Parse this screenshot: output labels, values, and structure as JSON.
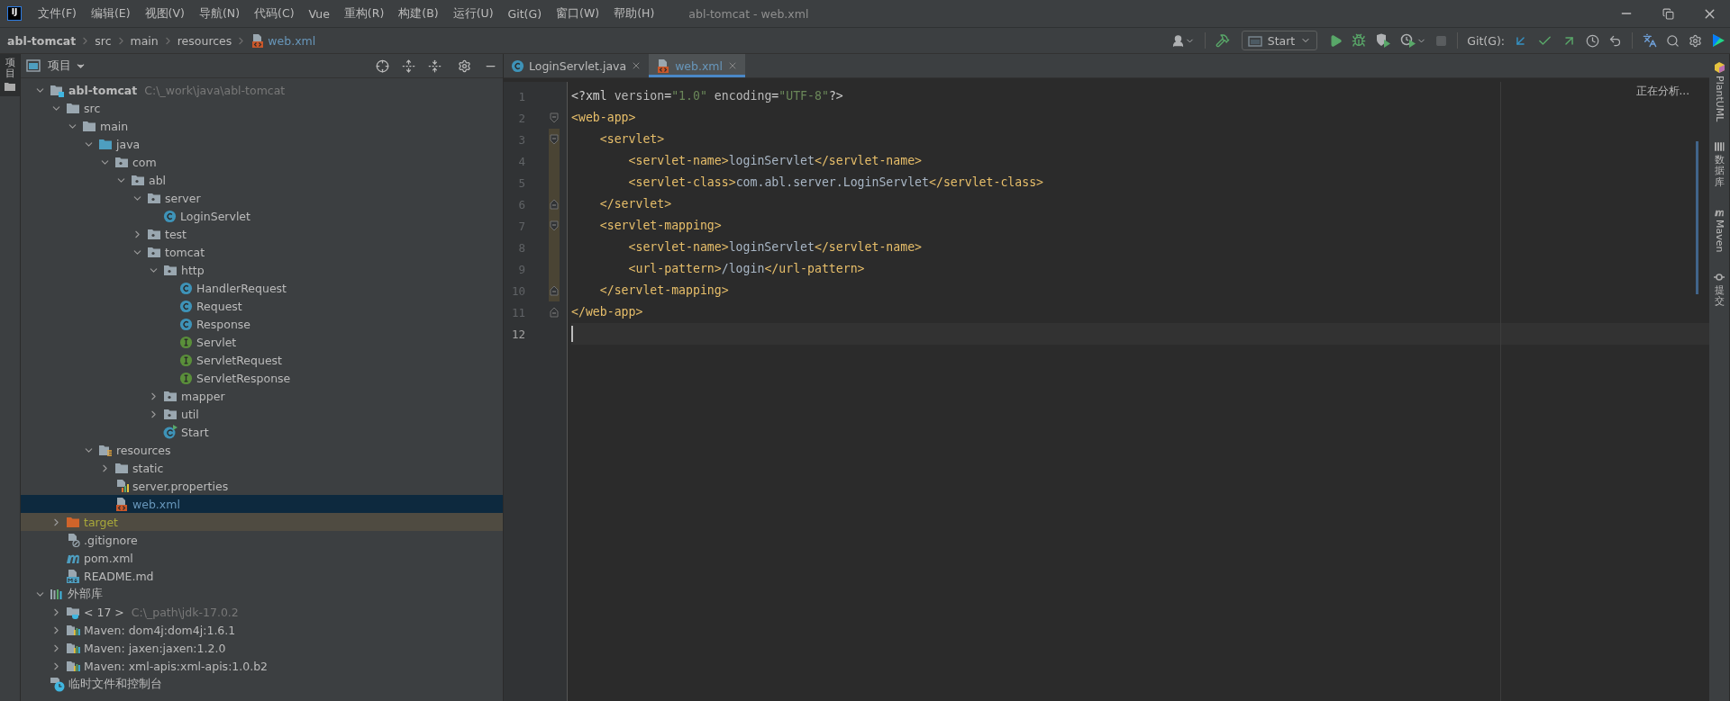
{
  "window": {
    "logo": "IJ",
    "title": "abl-tomcat - web.xml"
  },
  "menu": [
    "文件(F)",
    "编辑(E)",
    "视图(V)",
    "导航(N)",
    "代码(C)",
    "Vue",
    "重构(R)",
    "构建(B)",
    "运行(U)",
    "Git(G)",
    "窗口(W)",
    "帮助(H)"
  ],
  "breadcrumb": [
    {
      "label": "abl-tomcat",
      "kind": "project"
    },
    {
      "label": "src",
      "kind": "folder"
    },
    {
      "label": "main",
      "kind": "folder"
    },
    {
      "label": "resources",
      "kind": "folder"
    },
    {
      "label": "web.xml",
      "kind": "xml"
    }
  ],
  "toolbar": {
    "run_config": "Start",
    "git_label": "Git(G):",
    "stop_disabled": true
  },
  "left_strip": [
    {
      "label": "项目",
      "selected": true
    }
  ],
  "project_panel": {
    "title": "项目",
    "tree": [
      {
        "label": "abl-tomcat",
        "kind": "project",
        "hint": "C:\\_work\\java\\abl-tomcat",
        "expanded": true,
        "selected": false,
        "children": [
          {
            "label": "src",
            "kind": "folder",
            "expanded": true,
            "selected": false,
            "children": [
              {
                "label": "main",
                "kind": "folder",
                "expanded": true,
                "selected": false,
                "children": [
                  {
                    "label": "java",
                    "kind": "source-root",
                    "expanded": true,
                    "selected": false,
                    "children": [
                      {
                        "label": "com",
                        "kind": "package",
                        "expanded": true,
                        "selected": false,
                        "children": [
                          {
                            "label": "abl",
                            "kind": "package",
                            "expanded": true,
                            "selected": false,
                            "children": [
                              {
                                "label": "server",
                                "kind": "package",
                                "expanded": true,
                                "selected": false,
                                "children": [
                                  {
                                    "label": "LoginServlet",
                                    "kind": "class",
                                    "selected": false
                                  }
                                ]
                              },
                              {
                                "label": "test",
                                "kind": "package",
                                "expanded": false,
                                "selected": false
                              },
                              {
                                "label": "tomcat",
                                "kind": "package",
                                "expanded": true,
                                "selected": false,
                                "children": [
                                  {
                                    "label": "http",
                                    "kind": "package",
                                    "expanded": true,
                                    "selected": false,
                                    "children": [
                                      {
                                        "label": "HandlerRequest",
                                        "kind": "class",
                                        "selected": false
                                      },
                                      {
                                        "label": "Request",
                                        "kind": "class",
                                        "selected": false
                                      },
                                      {
                                        "label": "Response",
                                        "kind": "class",
                                        "selected": false
                                      },
                                      {
                                        "label": "Servlet",
                                        "kind": "interface",
                                        "selected": false
                                      },
                                      {
                                        "label": "ServletRequest",
                                        "kind": "interface",
                                        "selected": false
                                      },
                                      {
                                        "label": "ServletResponse",
                                        "kind": "interface",
                                        "selected": false
                                      }
                                    ]
                                  },
                                  {
                                    "label": "mapper",
                                    "kind": "package",
                                    "expanded": false,
                                    "selected": false
                                  },
                                  {
                                    "label": "util",
                                    "kind": "package",
                                    "expanded": false,
                                    "selected": false
                                  },
                                  {
                                    "label": "Start",
                                    "kind": "main-class",
                                    "selected": false
                                  }
                                ]
                              }
                            ]
                          }
                        ]
                      }
                    ]
                  },
                  {
                    "label": "resources",
                    "kind": "resources-root",
                    "expanded": true,
                    "selected": false,
                    "children": [
                      {
                        "label": "static",
                        "kind": "folder",
                        "expanded": false,
                        "selected": false
                      },
                      {
                        "label": "server.properties",
                        "kind": "properties",
                        "selected": false
                      },
                      {
                        "label": "web.xml",
                        "kind": "xml",
                        "selected": true
                      }
                    ]
                  }
                ]
              }
            ]
          },
          {
            "label": "target",
            "kind": "excluded-folder",
            "expanded": false,
            "selected": false
          },
          {
            "label": ".gitignore",
            "kind": "gitignore",
            "selected": false
          },
          {
            "label": "pom.xml",
            "kind": "maven",
            "selected": false
          },
          {
            "label": "README.md",
            "kind": "markdown",
            "selected": false
          }
        ]
      },
      {
        "label": "外部库",
        "kind": "libraries",
        "expanded": true,
        "selected": false,
        "children": [
          {
            "label": "< 17 >",
            "kind": "sdk",
            "hint": "C:\\_path\\jdk-17.0.2",
            "expanded": false,
            "selected": false
          },
          {
            "label": "Maven: dom4j:dom4j:1.6.1",
            "kind": "library",
            "expanded": false,
            "selected": false
          },
          {
            "label": "Maven: jaxen:jaxen:1.2.0",
            "kind": "library",
            "expanded": false,
            "selected": false
          },
          {
            "label": "Maven: xml-apis:xml-apis:1.0.b2",
            "kind": "library",
            "expanded": false,
            "selected": false
          }
        ]
      },
      {
        "label": "临时文件和控制台",
        "kind": "scratches",
        "selected": false
      }
    ]
  },
  "editor": {
    "tabs": [
      {
        "label": "LoginServlet.java",
        "kind": "class",
        "selected": false
      },
      {
        "label": "web.xml",
        "kind": "xml",
        "selected": true
      }
    ],
    "status": "正在分析...",
    "lines": [
      {
        "number": "1",
        "tokens": [
          {
            "kind": "punct",
            "text": "<?xml "
          },
          {
            "kind": "attr",
            "text": "version"
          },
          {
            "kind": "punct",
            "text": "="
          },
          {
            "kind": "value",
            "text": "\"1.0\""
          },
          {
            "kind": "attr",
            "text": " encoding"
          },
          {
            "kind": "punct",
            "text": "="
          },
          {
            "kind": "value",
            "text": "\"UTF-8\""
          },
          {
            "kind": "punct",
            "text": "?>"
          }
        ]
      },
      {
        "number": "2",
        "fold_start": true,
        "tokens": [
          {
            "kind": "tag",
            "text": "<web-app>"
          }
        ]
      },
      {
        "number": "3",
        "fold_start": true,
        "tokens": [
          {
            "kind": "tag",
            "text": "    <servlet>"
          }
        ]
      },
      {
        "number": "4",
        "tokens": [
          {
            "kind": "tag",
            "text": "        <servlet-name>"
          },
          {
            "kind": "text",
            "text": "loginServlet"
          },
          {
            "kind": "tag",
            "text": "</servlet-name>"
          }
        ]
      },
      {
        "number": "5",
        "tokens": [
          {
            "kind": "tag",
            "text": "        <servlet-class>"
          },
          {
            "kind": "text",
            "text": "com.abl.server.LoginServlet"
          },
          {
            "kind": "tag",
            "text": "</servlet-class>"
          }
        ]
      },
      {
        "number": "6",
        "fold_end": true,
        "tokens": [
          {
            "kind": "tag",
            "text": "    </servlet>"
          }
        ]
      },
      {
        "number": "7",
        "fold_start": true,
        "tokens": [
          {
            "kind": "tag",
            "text": "    <servlet-mapping>"
          }
        ]
      },
      {
        "number": "8",
        "tokens": [
          {
            "kind": "tag",
            "text": "        <servlet-name>"
          },
          {
            "kind": "text",
            "text": "loginServlet"
          },
          {
            "kind": "tag",
            "text": "</servlet-name>"
          }
        ]
      },
      {
        "number": "9",
        "tokens": [
          {
            "kind": "tag",
            "text": "        <url-pattern>"
          },
          {
            "kind": "text",
            "text": "/login"
          },
          {
            "kind": "tag",
            "text": "</url-pattern>"
          }
        ]
      },
      {
        "number": "10",
        "fold_end": true,
        "tokens": [
          {
            "kind": "tag",
            "text": "    </servlet-mapping>"
          }
        ]
      },
      {
        "number": "11",
        "fold_end": true,
        "tokens": [
          {
            "kind": "tag",
            "text": "</web-app>"
          }
        ]
      },
      {
        "number": "12",
        "current": true
      }
    ]
  },
  "right_strip": [
    {
      "label": "PlantUML",
      "kind": "plantuml"
    },
    {
      "label": "数据库",
      "kind": "database"
    },
    {
      "label": "Maven",
      "kind": "maven"
    },
    {
      "label": "提交",
      "kind": "commit"
    }
  ]
}
